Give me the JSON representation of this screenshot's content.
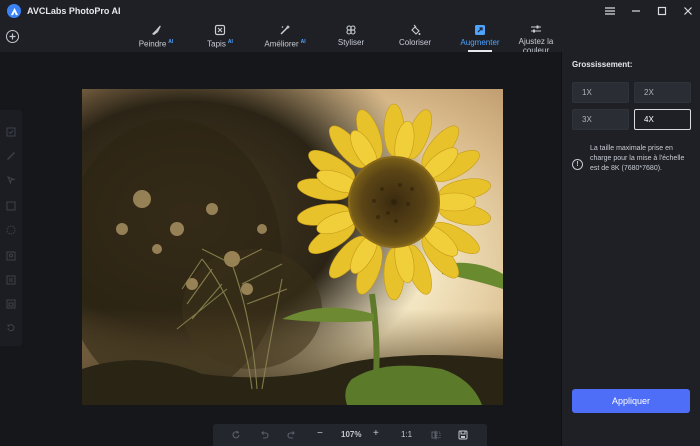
{
  "app": {
    "title": "AVCLabs PhotoPro AI"
  },
  "tabs": [
    {
      "label": "Peindre",
      "ai": "AI",
      "icon": "paint-icon"
    },
    {
      "label": "Tapis",
      "ai": "AI",
      "icon": "carpet-icon"
    },
    {
      "label": "Améliorer",
      "ai": "AI",
      "icon": "enhance-icon"
    },
    {
      "label": "Styliser",
      "ai": "",
      "icon": "stylize-icon"
    },
    {
      "label": "Coloriser",
      "ai": "",
      "icon": "colorize-icon"
    },
    {
      "label": "Augmenter",
      "ai": "",
      "icon": "upscale-icon",
      "active": true
    },
    {
      "label": "Ajustez la",
      "label2": "couleur",
      "ai": "",
      "icon": "adjust-color-icon"
    }
  ],
  "bottom_bar": {
    "zoom": "107%",
    "minus": "−",
    "plus": "+",
    "ratio": "1:1"
  },
  "panel": {
    "title": "Grossissement:",
    "scales": [
      "1X",
      "2X",
      "3X",
      "4X"
    ],
    "selected_scale": "4X",
    "info": "La taille maximale prise en charge pour la mise à l'échelle est de 8K (7680*7680).",
    "apply": "Appliquer"
  },
  "colors": {
    "accent": "#4ea3ff",
    "apply_button": "#4f6ef7",
    "background": "#1e2026"
  }
}
